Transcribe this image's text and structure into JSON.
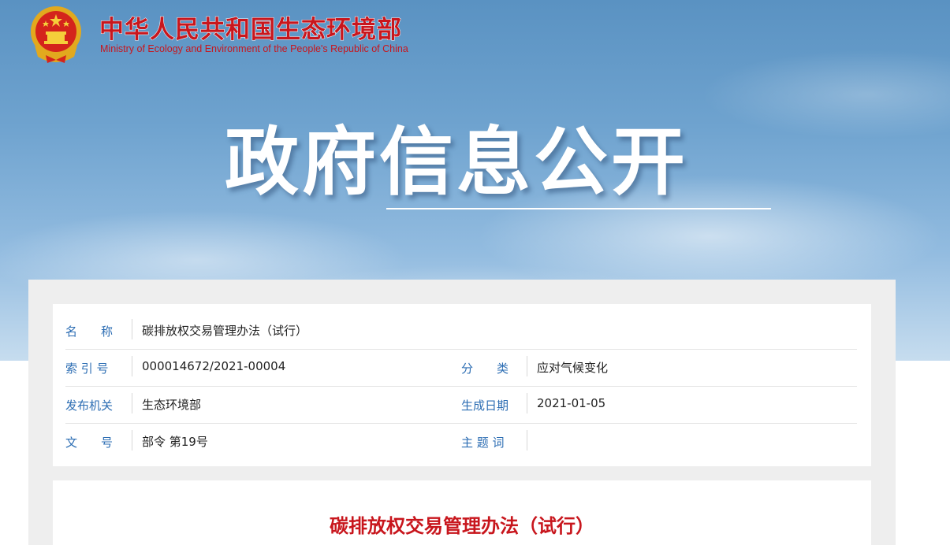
{
  "header": {
    "title": "中华人民共和国生态环境部",
    "subtitle": "Ministry of Ecology and Environment of the People's Republic of China",
    "emblem_icon": "national-emblem-icon"
  },
  "hero": {
    "title": "政府信息公开"
  },
  "metadata": {
    "name_label": "名　　称",
    "name_value": "碳排放权交易管理办法（试行）",
    "index_label": "索 引 号",
    "index_value": "000014672/2021-00004",
    "category_label": "分　　类",
    "category_value": "应对气候变化",
    "issuer_label": "发布机关",
    "issuer_value": "生态环境部",
    "date_label": "生成日期",
    "date_value": "2021-01-05",
    "doc_no_label": "文　　号",
    "doc_no_value": "部令 第19号",
    "keywords_label": "主 题 词",
    "keywords_value": ""
  },
  "document": {
    "title": "碳排放权交易管理办法（试行）"
  },
  "colors": {
    "brand_red": "#c8161d",
    "label_blue": "#2c6db3",
    "sky_blue": "#6fa3cf"
  }
}
